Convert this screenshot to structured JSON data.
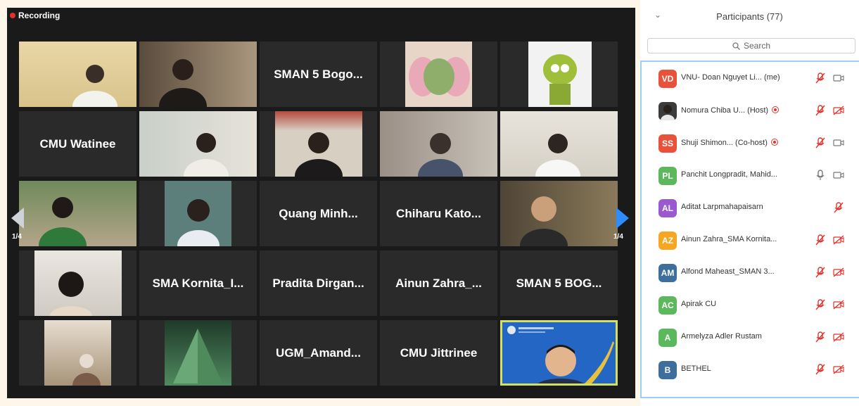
{
  "recording_label": "Recording",
  "gallery": {
    "page_left": "1/4",
    "page_right": "1/4",
    "tiles": [
      {
        "type": "photo",
        "name": ""
      },
      {
        "type": "photo",
        "name": ""
      },
      {
        "type": "name",
        "name": "SMAN 5 Bogo..."
      },
      {
        "type": "photo",
        "name": ""
      },
      {
        "type": "photo",
        "name": ""
      },
      {
        "type": "name",
        "name": "CMU Watinee"
      },
      {
        "type": "photo",
        "name": ""
      },
      {
        "type": "photo",
        "name": ""
      },
      {
        "type": "photo",
        "name": ""
      },
      {
        "type": "photo",
        "name": ""
      },
      {
        "type": "photo",
        "name": ""
      },
      {
        "type": "photo",
        "name": ""
      },
      {
        "type": "name",
        "name": "Quang Minh..."
      },
      {
        "type": "name",
        "name": "Chiharu Kato..."
      },
      {
        "type": "photo",
        "name": ""
      },
      {
        "type": "photo",
        "name": ""
      },
      {
        "type": "name",
        "name": "SMA Kornita_I..."
      },
      {
        "type": "name",
        "name": "Pradita Dirgan..."
      },
      {
        "type": "name",
        "name": "Ainun Zahra_..."
      },
      {
        "type": "name",
        "name": "SMAN 5 BOG..."
      },
      {
        "type": "photo",
        "name": ""
      },
      {
        "type": "photo",
        "name": ""
      },
      {
        "type": "name",
        "name": "UGM_Amand..."
      },
      {
        "type": "name",
        "name": "CMU Jittrinee"
      },
      {
        "type": "photo",
        "name": ""
      }
    ]
  },
  "participants": {
    "title": "Participants (77)",
    "search_placeholder": "Search",
    "items": [
      {
        "initials": "VD",
        "name": "VNU- Doan Nguyet Li...",
        "role": "(me)",
        "color": "#e8523a",
        "mic": "muted",
        "cam": "off-gray",
        "rec": false
      },
      {
        "initials": "",
        "name": "Nomura Chiba U...",
        "role": "(Host)",
        "color": "#3b3b3b",
        "mic": "muted",
        "cam": "off-red",
        "rec": true
      },
      {
        "initials": "SS",
        "name": "Shuji Shimon...",
        "role": "(Co-host)",
        "color": "#e8523a",
        "mic": "muted",
        "cam": "off-gray",
        "rec": true
      },
      {
        "initials": "PL",
        "name": "Panchit Longpradit, Mahid...",
        "role": "",
        "color": "#5cb85c",
        "mic": "on",
        "cam": "off-gray",
        "rec": false
      },
      {
        "initials": "AL",
        "name": "Aditat Larpmahapaisarn",
        "role": "",
        "color": "#9b59d0",
        "mic": "muted",
        "cam": "none",
        "rec": false
      },
      {
        "initials": "AZ",
        "name": "Ainun Zahra_SMA Kornita...",
        "role": "",
        "color": "#f5a623",
        "mic": "muted",
        "cam": "off-red",
        "rec": false
      },
      {
        "initials": "AM",
        "name": "Alfond Maheast_SMAN 3...",
        "role": "",
        "color": "#3e6f9c",
        "mic": "muted",
        "cam": "off-red",
        "rec": false
      },
      {
        "initials": "AC",
        "name": "Apirak CU",
        "role": "",
        "color": "#5cb85c",
        "mic": "muted",
        "cam": "off-red",
        "rec": false
      },
      {
        "initials": "A",
        "name": "Armelyza Adler Rustam",
        "role": "",
        "color": "#5cb85c",
        "mic": "muted",
        "cam": "off-red",
        "rec": false
      },
      {
        "initials": "B",
        "name": "BETHEL",
        "role": "",
        "color": "#3e6f9c",
        "mic": "muted",
        "cam": "off-red",
        "rec": false
      }
    ]
  }
}
